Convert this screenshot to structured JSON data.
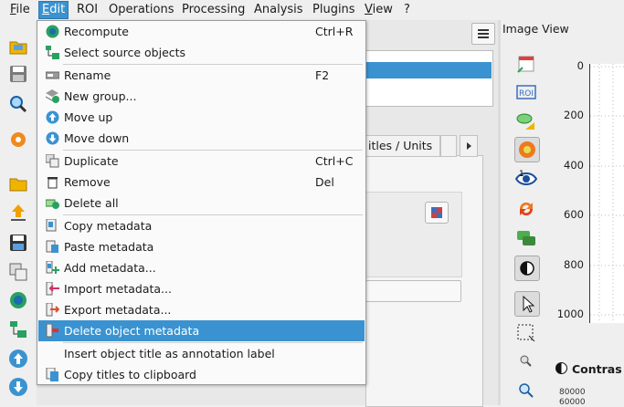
{
  "menubar": {
    "items": [
      {
        "label": "File",
        "accel": "F",
        "rest": "ile"
      },
      {
        "label": "Edit",
        "accel": "E",
        "rest": "dit"
      },
      {
        "label": "ROI",
        "accel": "",
        "rest": "ROI"
      },
      {
        "label": "Operations",
        "accel": "",
        "rest": "Operations"
      },
      {
        "label": "Processing",
        "accel": "",
        "rest": "Processing"
      },
      {
        "label": "Analysis",
        "accel": "",
        "rest": "Analysis"
      },
      {
        "label": "Plugins",
        "accel": "",
        "rest": "Plugins"
      },
      {
        "label": "View",
        "accel": "V",
        "rest": "iew"
      },
      {
        "label": "?",
        "accel": "",
        "rest": "?"
      }
    ]
  },
  "edit_menu": {
    "items": [
      {
        "label": "Recompute",
        "shortcut": "Ctrl+R",
        "icon": "recompute-icon"
      },
      {
        "label": "Select source objects",
        "shortcut": "",
        "icon": "select-source-icon"
      },
      {
        "label": "Rename",
        "shortcut": "F2",
        "icon": "rename-icon"
      },
      {
        "label": "New group...",
        "shortcut": "",
        "icon": "new-group-icon"
      },
      {
        "label": "Move up",
        "shortcut": "",
        "icon": "move-up-icon"
      },
      {
        "label": "Move down",
        "shortcut": "",
        "icon": "move-down-icon"
      },
      {
        "label": "Duplicate",
        "shortcut": "Ctrl+C",
        "icon": "duplicate-icon"
      },
      {
        "label": "Remove",
        "shortcut": "Del",
        "icon": "trash-icon"
      },
      {
        "label": "Delete all",
        "shortcut": "",
        "icon": "delete-all-icon"
      },
      {
        "label": "Copy metadata",
        "shortcut": "",
        "icon": "copy-metadata-icon"
      },
      {
        "label": "Paste metadata",
        "shortcut": "",
        "icon": "paste-metadata-icon"
      },
      {
        "label": "Add metadata...",
        "shortcut": "",
        "icon": "add-metadata-icon"
      },
      {
        "label": "Import metadata...",
        "shortcut": "",
        "icon": "import-metadata-icon"
      },
      {
        "label": "Export metadata...",
        "shortcut": "",
        "icon": "export-metadata-icon"
      },
      {
        "label": "Delete object metadata",
        "shortcut": "",
        "icon": "delete-metadata-icon"
      },
      {
        "label": "Insert object title as annotation label",
        "shortcut": "",
        "icon": ""
      },
      {
        "label": "Copy titles to clipboard",
        "shortcut": "",
        "icon": "copy-titles-icon"
      }
    ],
    "highlighted_index": 14
  },
  "properties": {
    "tab_label": "itles / Units"
  },
  "image_view": {
    "title": "Image View",
    "y_ticks": [
      "0",
      "200",
      "400",
      "600",
      "800",
      "1000"
    ],
    "contrast_label": "Contras",
    "contrast_ticks": [
      "80000",
      "60000"
    ]
  },
  "colors": {
    "accent": "#3a93d0",
    "menu_bg": "#fafafa",
    "window_bg": "#efefef"
  }
}
